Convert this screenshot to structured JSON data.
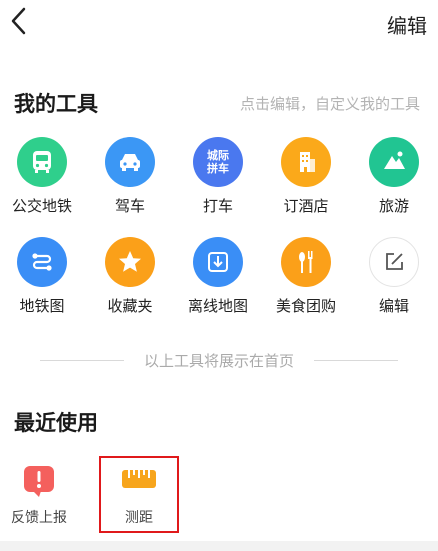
{
  "header": {
    "edit_label": "编辑"
  },
  "my_tools": {
    "title": "我的工具",
    "hint": "点击编辑，自定义我的工具",
    "items": [
      {
        "label": "公交地铁",
        "icon": "bus-icon",
        "color": "#2fcf8c"
      },
      {
        "label": "驾车",
        "icon": "car-icon",
        "color": "#3b97f5"
      },
      {
        "label": "打车",
        "icon": "taxi-badge-icon",
        "color": "#4a78ef",
        "icon_text_1": "城际",
        "icon_text_2": "拼车"
      },
      {
        "label": "订酒店",
        "icon": "hotel-icon",
        "color": "#fba91a"
      },
      {
        "label": "旅游",
        "icon": "travel-icon",
        "color": "#21c592"
      },
      {
        "label": "地铁图",
        "icon": "subway-map-icon",
        "color": "#3a8ef6"
      },
      {
        "label": "收藏夹",
        "icon": "star-icon",
        "color": "#fba019"
      },
      {
        "label": "离线地图",
        "icon": "download-icon",
        "color": "#3a8ef6"
      },
      {
        "label": "美食团购",
        "icon": "food-icon",
        "color": "#fba019"
      },
      {
        "label": "编辑",
        "icon": "edit-icon",
        "color": "#ffffff"
      }
    ]
  },
  "divider_text": "以上工具将展示在首页",
  "recent": {
    "title": "最近使用",
    "items": [
      {
        "label": "反馈上报",
        "icon": "feedback-alert-icon",
        "color": "#f4605d"
      },
      {
        "label": "测距",
        "icon": "ruler-icon",
        "color": "#f7a51c"
      }
    ]
  }
}
